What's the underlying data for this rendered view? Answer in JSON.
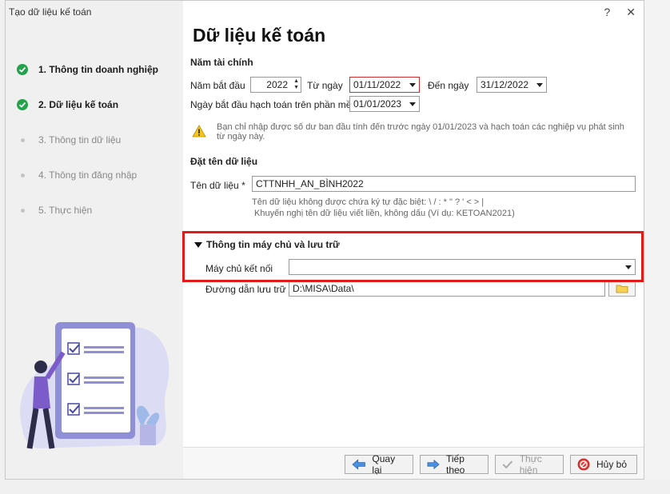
{
  "window": {
    "title": "Tạo dữ liệu kế toán",
    "help": "?",
    "close": "✕"
  },
  "steps": [
    {
      "label": "1. Thông tin doanh nghiệp",
      "state": "done"
    },
    {
      "label": "2. Dữ liệu kế toán",
      "state": "done"
    },
    {
      "label": "3. Thông tin dữ liệu",
      "state": "todo"
    },
    {
      "label": "4. Thông tin đăng nhập",
      "state": "todo"
    },
    {
      "label": "5. Thực hiện",
      "state": "todo"
    }
  ],
  "page_title": "Dữ liệu kế toán",
  "fiscal": {
    "heading": "Năm tài chính",
    "start_year_label": "Năm bắt đầu",
    "start_year_value": "2022",
    "from_label": "Từ ngày",
    "from_value": "01/11/2022",
    "to_label": "Đến ngày",
    "to_value": "31/12/2022",
    "accounting_start_label": "Ngày bắt đầu hạch toán trên phần mềm",
    "accounting_start_value": "01/01/2023",
    "warning": "Bạn chỉ nhập được số dư ban đầu tính đến trước ngày 01/01/2023 và hạch toán các nghiệp vụ phát sinh từ ngày này."
  },
  "naming": {
    "heading": "Đặt tên dữ liệu",
    "name_label": "Tên dữ liệu *",
    "name_value": "CTTNHH_AN_BÌNH2022",
    "hint1": "Tên dữ liệu không được chứa ký tự đặc biệt: \\ / : * \" ? ' < > |",
    "hint2": "Khuyến nghị tên dữ liệu viết liền, không dấu (Ví dụ: KETOAN2021)"
  },
  "server": {
    "heading": "Thông tin máy chủ và lưu trữ",
    "server_label": "Máy chủ kết nối",
    "server_value": "",
    "path_label": "Đường dẫn lưu trữ *",
    "path_value": "D:\\MISA\\Data\\"
  },
  "footer": {
    "back": "Quay lại",
    "next": "Tiếp theo",
    "execute": "Thực hiện",
    "cancel": "Hủy bỏ"
  },
  "colors": {
    "done": "#22a34a",
    "highlight": "#e01b1b",
    "accent": "#2f6fd6"
  }
}
